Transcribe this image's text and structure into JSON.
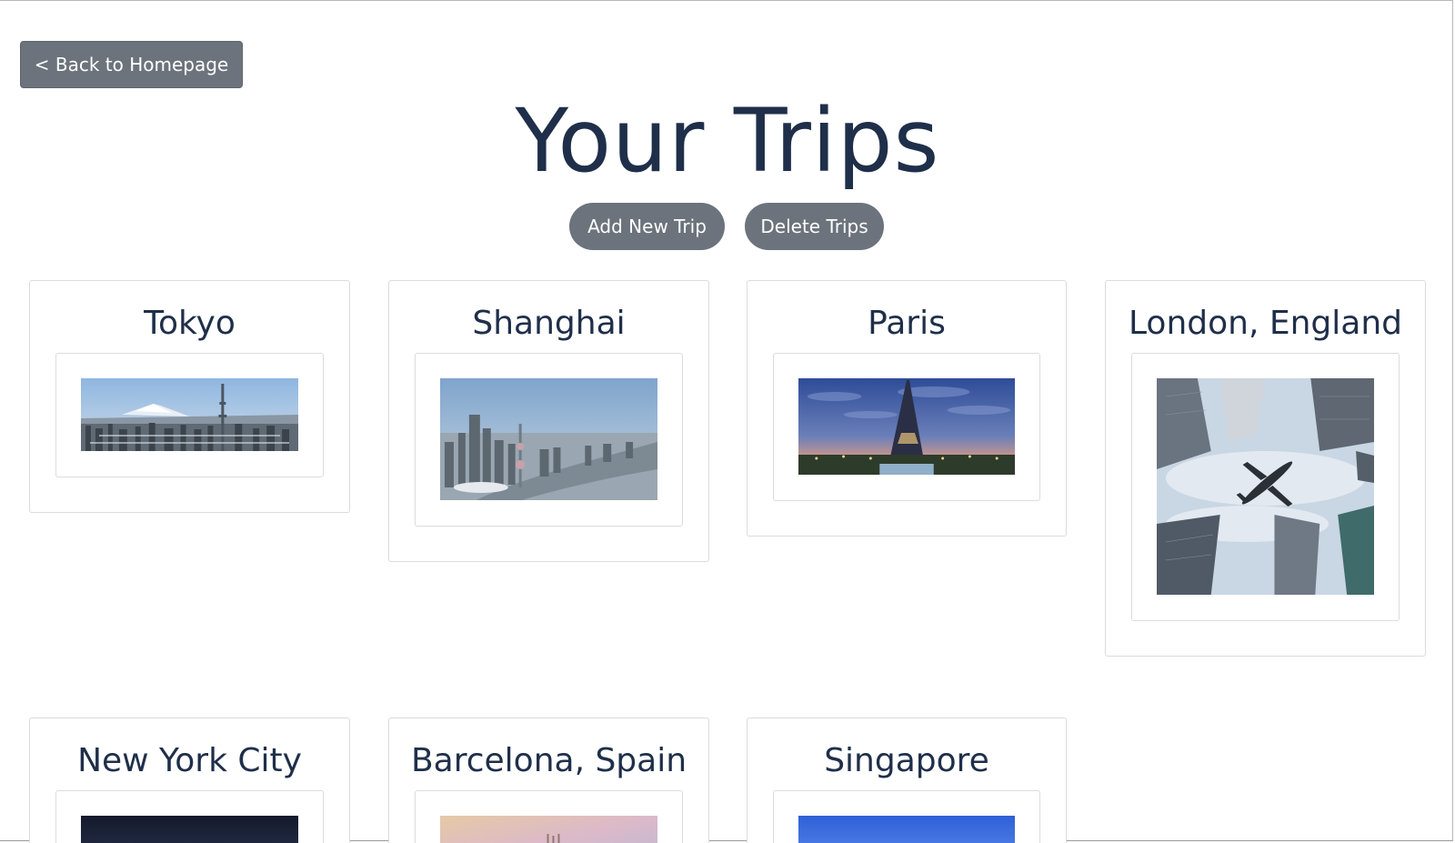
{
  "nav": {
    "back_label": "< Back to Homepage"
  },
  "page": {
    "title": "Your Trips"
  },
  "actions": {
    "add_label": "Add New Trip",
    "delete_label": "Delete Trips"
  },
  "trips": [
    {
      "name": "Tokyo",
      "image": "tokyo-skyline-image"
    },
    {
      "name": "Shanghai",
      "image": "shanghai-skyline-image"
    },
    {
      "name": "Paris",
      "image": "eiffel-tower-image"
    },
    {
      "name": "London, England",
      "image": "airplane-skyscrapers-image"
    },
    {
      "name": "New York City",
      "image": "new-york-night-image"
    },
    {
      "name": "Barcelona, Spain",
      "image": "barcelona-sunset-image"
    },
    {
      "name": "Singapore",
      "image": "singapore-sky-image"
    }
  ],
  "colors": {
    "button_gray": "#6c737c",
    "title_navy": "#1f2f4a",
    "card_border": "#dcdcdc"
  }
}
